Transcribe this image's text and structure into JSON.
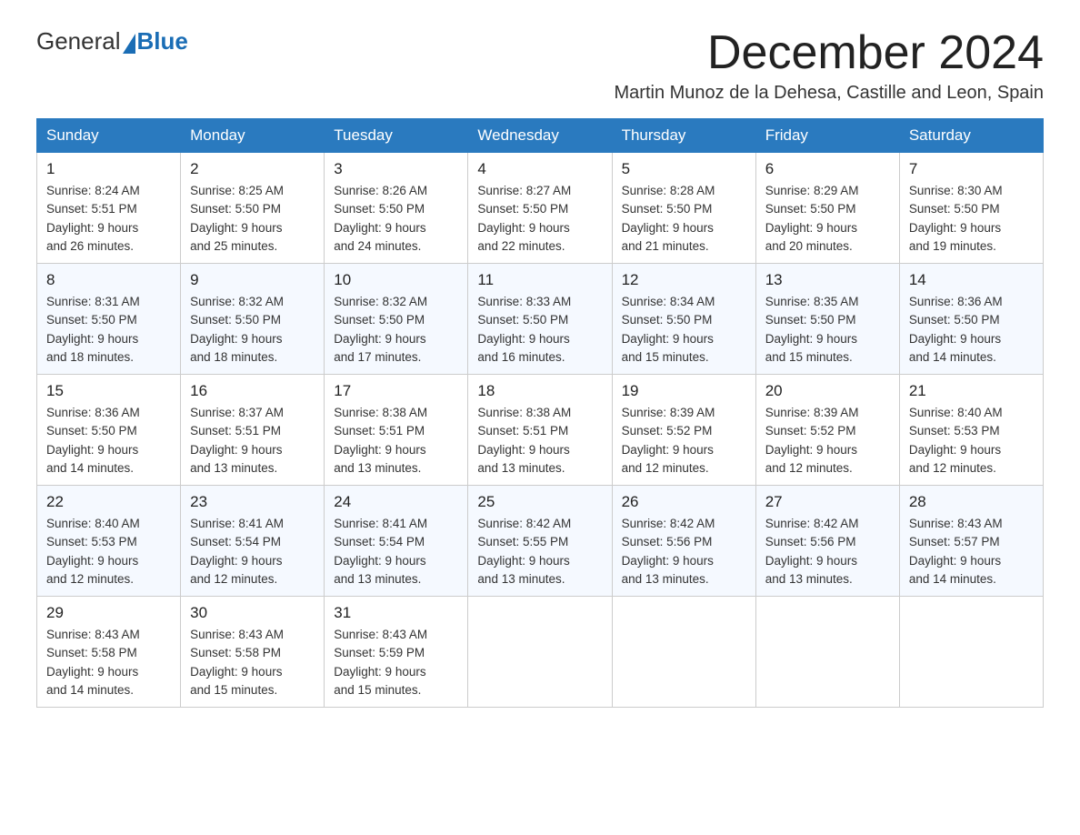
{
  "logo": {
    "general": "General",
    "blue": "Blue"
  },
  "title": "December 2024",
  "subtitle": "Martin Munoz de la Dehesa, Castille and Leon, Spain",
  "headers": [
    "Sunday",
    "Monday",
    "Tuesday",
    "Wednesday",
    "Thursday",
    "Friday",
    "Saturday"
  ],
  "weeks": [
    [
      {
        "day": "1",
        "sunrise": "8:24 AM",
        "sunset": "5:51 PM",
        "daylight": "9 hours and 26 minutes."
      },
      {
        "day": "2",
        "sunrise": "8:25 AM",
        "sunset": "5:50 PM",
        "daylight": "9 hours and 25 minutes."
      },
      {
        "day": "3",
        "sunrise": "8:26 AM",
        "sunset": "5:50 PM",
        "daylight": "9 hours and 24 minutes."
      },
      {
        "day": "4",
        "sunrise": "8:27 AM",
        "sunset": "5:50 PM",
        "daylight": "9 hours and 22 minutes."
      },
      {
        "day": "5",
        "sunrise": "8:28 AM",
        "sunset": "5:50 PM",
        "daylight": "9 hours and 21 minutes."
      },
      {
        "day": "6",
        "sunrise": "8:29 AM",
        "sunset": "5:50 PM",
        "daylight": "9 hours and 20 minutes."
      },
      {
        "day": "7",
        "sunrise": "8:30 AM",
        "sunset": "5:50 PM",
        "daylight": "9 hours and 19 minutes."
      }
    ],
    [
      {
        "day": "8",
        "sunrise": "8:31 AM",
        "sunset": "5:50 PM",
        "daylight": "9 hours and 18 minutes."
      },
      {
        "day": "9",
        "sunrise": "8:32 AM",
        "sunset": "5:50 PM",
        "daylight": "9 hours and 18 minutes."
      },
      {
        "day": "10",
        "sunrise": "8:32 AM",
        "sunset": "5:50 PM",
        "daylight": "9 hours and 17 minutes."
      },
      {
        "day": "11",
        "sunrise": "8:33 AM",
        "sunset": "5:50 PM",
        "daylight": "9 hours and 16 minutes."
      },
      {
        "day": "12",
        "sunrise": "8:34 AM",
        "sunset": "5:50 PM",
        "daylight": "9 hours and 15 minutes."
      },
      {
        "day": "13",
        "sunrise": "8:35 AM",
        "sunset": "5:50 PM",
        "daylight": "9 hours and 15 minutes."
      },
      {
        "day": "14",
        "sunrise": "8:36 AM",
        "sunset": "5:50 PM",
        "daylight": "9 hours and 14 minutes."
      }
    ],
    [
      {
        "day": "15",
        "sunrise": "8:36 AM",
        "sunset": "5:50 PM",
        "daylight": "9 hours and 14 minutes."
      },
      {
        "day": "16",
        "sunrise": "8:37 AM",
        "sunset": "5:51 PM",
        "daylight": "9 hours and 13 minutes."
      },
      {
        "day": "17",
        "sunrise": "8:38 AM",
        "sunset": "5:51 PM",
        "daylight": "9 hours and 13 minutes."
      },
      {
        "day": "18",
        "sunrise": "8:38 AM",
        "sunset": "5:51 PM",
        "daylight": "9 hours and 13 minutes."
      },
      {
        "day": "19",
        "sunrise": "8:39 AM",
        "sunset": "5:52 PM",
        "daylight": "9 hours and 12 minutes."
      },
      {
        "day": "20",
        "sunrise": "8:39 AM",
        "sunset": "5:52 PM",
        "daylight": "9 hours and 12 minutes."
      },
      {
        "day": "21",
        "sunrise": "8:40 AM",
        "sunset": "5:53 PM",
        "daylight": "9 hours and 12 minutes."
      }
    ],
    [
      {
        "day": "22",
        "sunrise": "8:40 AM",
        "sunset": "5:53 PM",
        "daylight": "9 hours and 12 minutes."
      },
      {
        "day": "23",
        "sunrise": "8:41 AM",
        "sunset": "5:54 PM",
        "daylight": "9 hours and 12 minutes."
      },
      {
        "day": "24",
        "sunrise": "8:41 AM",
        "sunset": "5:54 PM",
        "daylight": "9 hours and 13 minutes."
      },
      {
        "day": "25",
        "sunrise": "8:42 AM",
        "sunset": "5:55 PM",
        "daylight": "9 hours and 13 minutes."
      },
      {
        "day": "26",
        "sunrise": "8:42 AM",
        "sunset": "5:56 PM",
        "daylight": "9 hours and 13 minutes."
      },
      {
        "day": "27",
        "sunrise": "8:42 AM",
        "sunset": "5:56 PM",
        "daylight": "9 hours and 13 minutes."
      },
      {
        "day": "28",
        "sunrise": "8:43 AM",
        "sunset": "5:57 PM",
        "daylight": "9 hours and 14 minutes."
      }
    ],
    [
      {
        "day": "29",
        "sunrise": "8:43 AM",
        "sunset": "5:58 PM",
        "daylight": "9 hours and 14 minutes."
      },
      {
        "day": "30",
        "sunrise": "8:43 AM",
        "sunset": "5:58 PM",
        "daylight": "9 hours and 15 minutes."
      },
      {
        "day": "31",
        "sunrise": "8:43 AM",
        "sunset": "5:59 PM",
        "daylight": "9 hours and 15 minutes."
      },
      null,
      null,
      null,
      null
    ]
  ]
}
